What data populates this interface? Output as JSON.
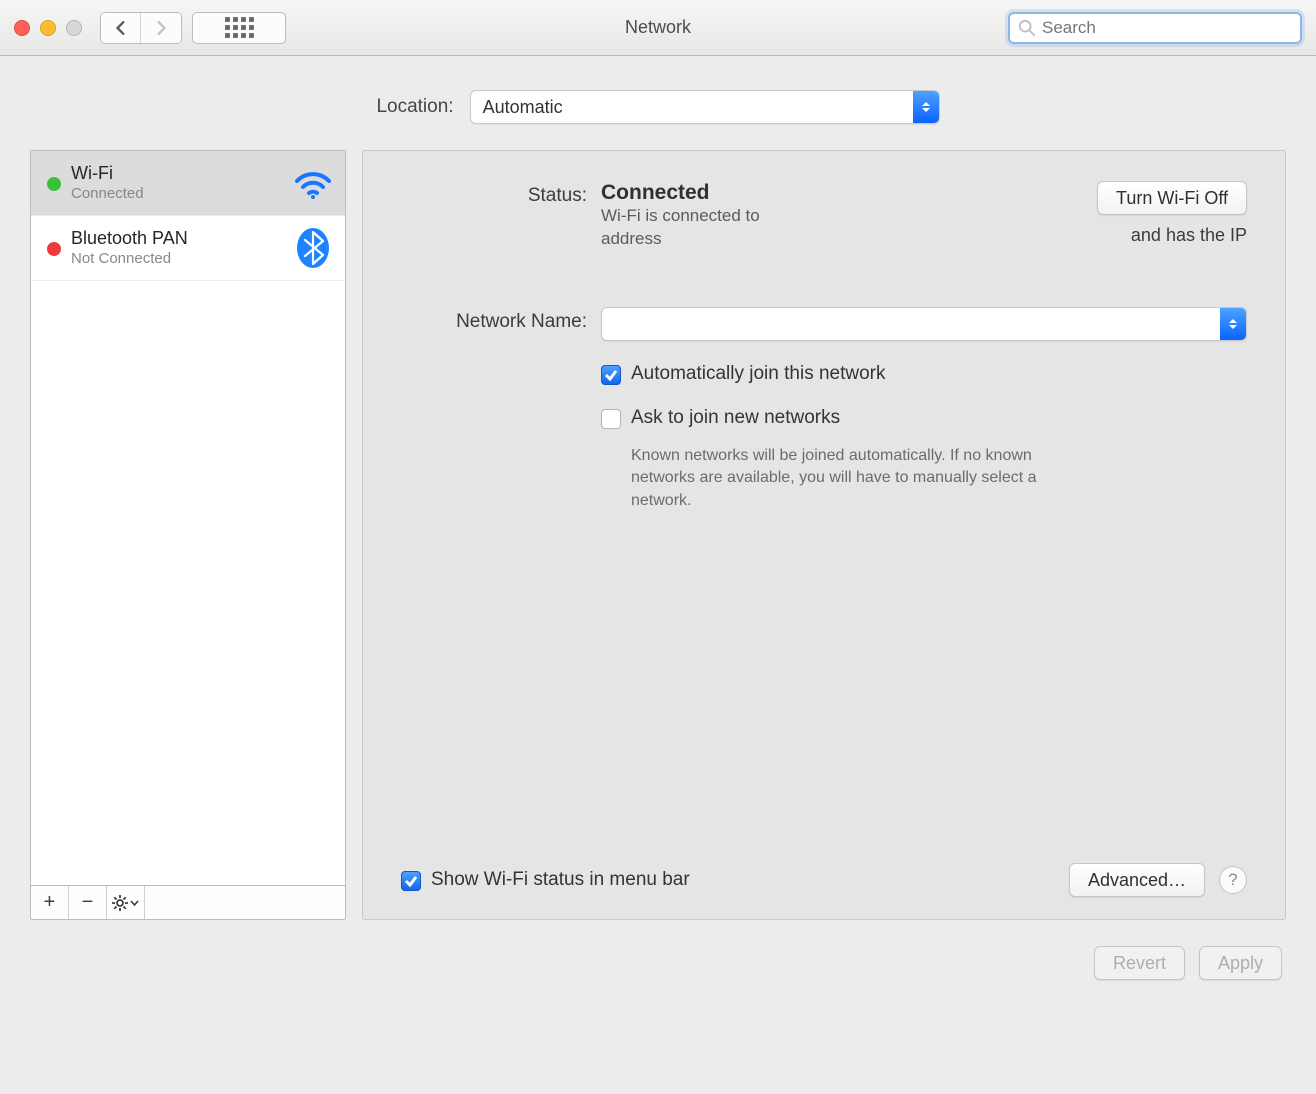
{
  "window": {
    "title": "Network",
    "search_placeholder": "Search",
    "back_disabled": false,
    "forward_disabled": true
  },
  "location": {
    "label": "Location:",
    "value": "Automatic"
  },
  "services": [
    {
      "name": "Wi-Fi",
      "status": "Connected",
      "dot": "green",
      "icon": "wifi",
      "selected": true
    },
    {
      "name": "Bluetooth PAN",
      "status": "Not Connected",
      "dot": "red",
      "icon": "bluetooth",
      "selected": false
    }
  ],
  "services_toolbar": {
    "add": "+",
    "remove": "−",
    "gear": "⚙"
  },
  "detail": {
    "status_label": "Status:",
    "status_value": "Connected",
    "toggle_button": "Turn Wi-Fi Off",
    "status_desc": "Wi-Fi is connected to",
    "status_desc2": "address",
    "status_extra": "and has the IP",
    "network_name_label": "Network Name:",
    "network_name_value": "",
    "auto_join": {
      "checked": true,
      "label": "Automatically join this network"
    },
    "ask_join": {
      "checked": false,
      "label": "Ask to join new networks",
      "help": "Known networks will be joined automatically. If no known networks are available, you will have to manually select a network."
    },
    "show_menubar": {
      "checked": true,
      "label": "Show Wi-Fi status in menu bar"
    },
    "advanced_button": "Advanced…"
  },
  "footer": {
    "revert": "Revert",
    "apply": "Apply"
  }
}
